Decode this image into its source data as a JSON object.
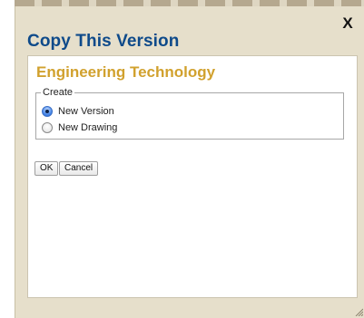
{
  "dialog": {
    "title": "Copy This Version",
    "close_label": "X"
  },
  "content": {
    "heading": "Engineering Technology"
  },
  "create": {
    "legend": "Create",
    "options": [
      {
        "label": "New Version",
        "selected": true
      },
      {
        "label": "New Drawing",
        "selected": false
      }
    ]
  },
  "buttons": {
    "ok_label": "OK",
    "cancel_label": "Cancel"
  },
  "icons": {
    "close": "close-icon",
    "resize": "resize-grip-icon"
  },
  "colors": {
    "dialog_bg": "#e6dfcb",
    "title": "#0e4a8a",
    "heading": "#d1a12e"
  }
}
